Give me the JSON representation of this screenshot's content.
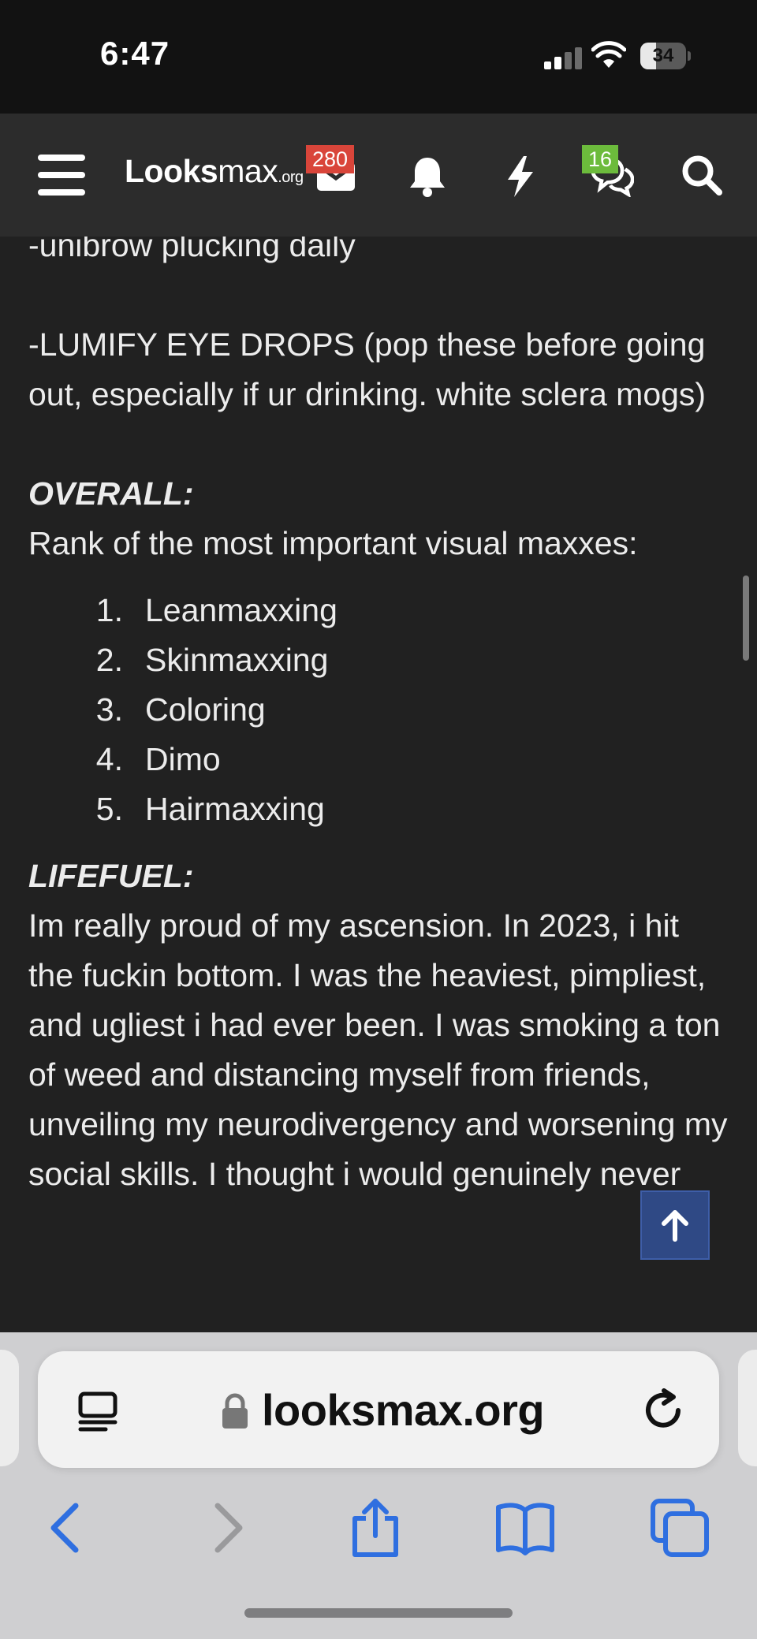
{
  "status_bar": {
    "time": "6:47",
    "battery": "34",
    "battery_level": 0.34
  },
  "header": {
    "logo_main": "Looks",
    "logo_sub": "max",
    "logo_tld": ".org",
    "inbox_badge": "280",
    "alerts_badge": "16",
    "icons": [
      "menu-icon",
      "inbox-icon",
      "bell-icon",
      "lightning-icon",
      "chat-icon",
      "search-icon"
    ]
  },
  "post": {
    "line_unibrow": "-unibrow plucking daily",
    "line_lumify": "-LUMIFY EYE DROPS (pop these before going out, especially if ur drinking. white sclera mogs)",
    "overall_heading": "OVERALL:",
    "rank_intro": "Rank of the most important visual maxxes:",
    "rank_list": [
      {
        "num": "1.",
        "label": "Leanmaxxing"
      },
      {
        "num": "2.",
        "label": "Skinmaxxing"
      },
      {
        "num": "3.",
        "label": "Coloring"
      },
      {
        "num": "4.",
        "label": "Dimo"
      },
      {
        "num": "5.",
        "label": "Hairmaxxing"
      }
    ],
    "lifefuel_heading": "LIFEFUEL:",
    "lifefuel_text": "Im really proud of my ascension. In 2023, i hit the fuckin bottom. I was the heaviest, pimpliest, and ugliest i had ever been. I was smoking a ton of weed and distancing myself from friends, unveiling my neurodivergency and worsening my social skills. I thought i would genuinely never"
  },
  "browser": {
    "url": "looksmax.org",
    "toolbar": [
      "back-icon",
      "forward-icon",
      "share-icon",
      "bookmarks-icon",
      "tabs-icon"
    ]
  },
  "colors": {
    "page_bg": "#212121",
    "header_bg": "#2c2c2c",
    "badge_red": "#d9453a",
    "badge_green": "#6cbb3c",
    "accent_blue": "#2f6fe0",
    "back_to_top_bg": "#2f4985"
  }
}
